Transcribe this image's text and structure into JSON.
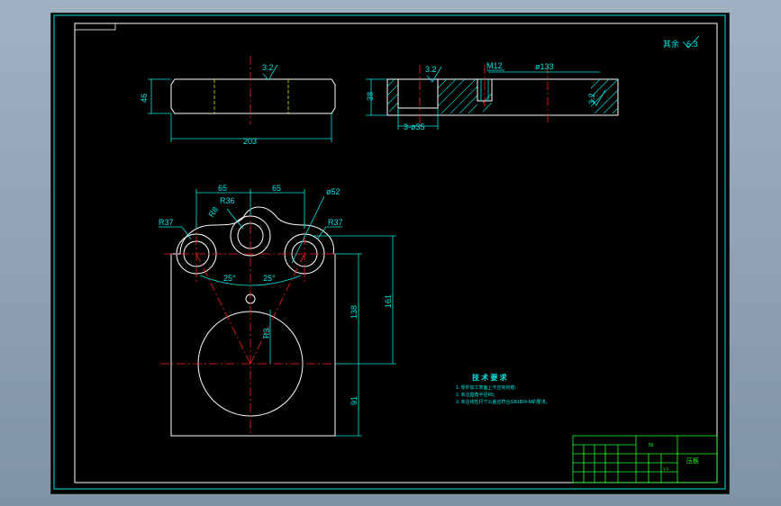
{
  "drawing": {
    "roughness_note": "其余",
    "roughness_value": "6.3",
    "top_view": {
      "roughness": "3.2",
      "width": "203",
      "height": "46"
    },
    "section_view": {
      "roughness_left": "3.2",
      "roughness_right": "3.2",
      "thread": "M12",
      "bore_dia": "ø133",
      "holes": "3-ø35",
      "height": "38"
    },
    "plan_view": {
      "dim_left": "65",
      "dim_right": "65",
      "r36": "R36",
      "r8": "R8",
      "dia52": "ø52",
      "r37_left": "R37",
      "r37_right": "R37",
      "ang_left": "25°",
      "ang_right": "25°",
      "dim_138": "138",
      "dim_161": "161",
      "dim_83": "R3",
      "dim_91": "91"
    },
    "tech": {
      "title": "技 术 要 求",
      "items": [
        "1. 零件加工表面上不应有划痕;",
        "2. 未注圆角半径R5;",
        "3. 未注线性尺寸公差应符合GB1804-M的要求。"
      ]
    },
    "title_block": {
      "part_name": "压板",
      "scale": "1:1",
      "sheet": "55"
    }
  },
  "colors": {
    "dimension": "#00e5e5",
    "outline": "#ffffff",
    "center": "#ff2020",
    "hidden": "#e8e800",
    "frame": "#22ff22"
  }
}
